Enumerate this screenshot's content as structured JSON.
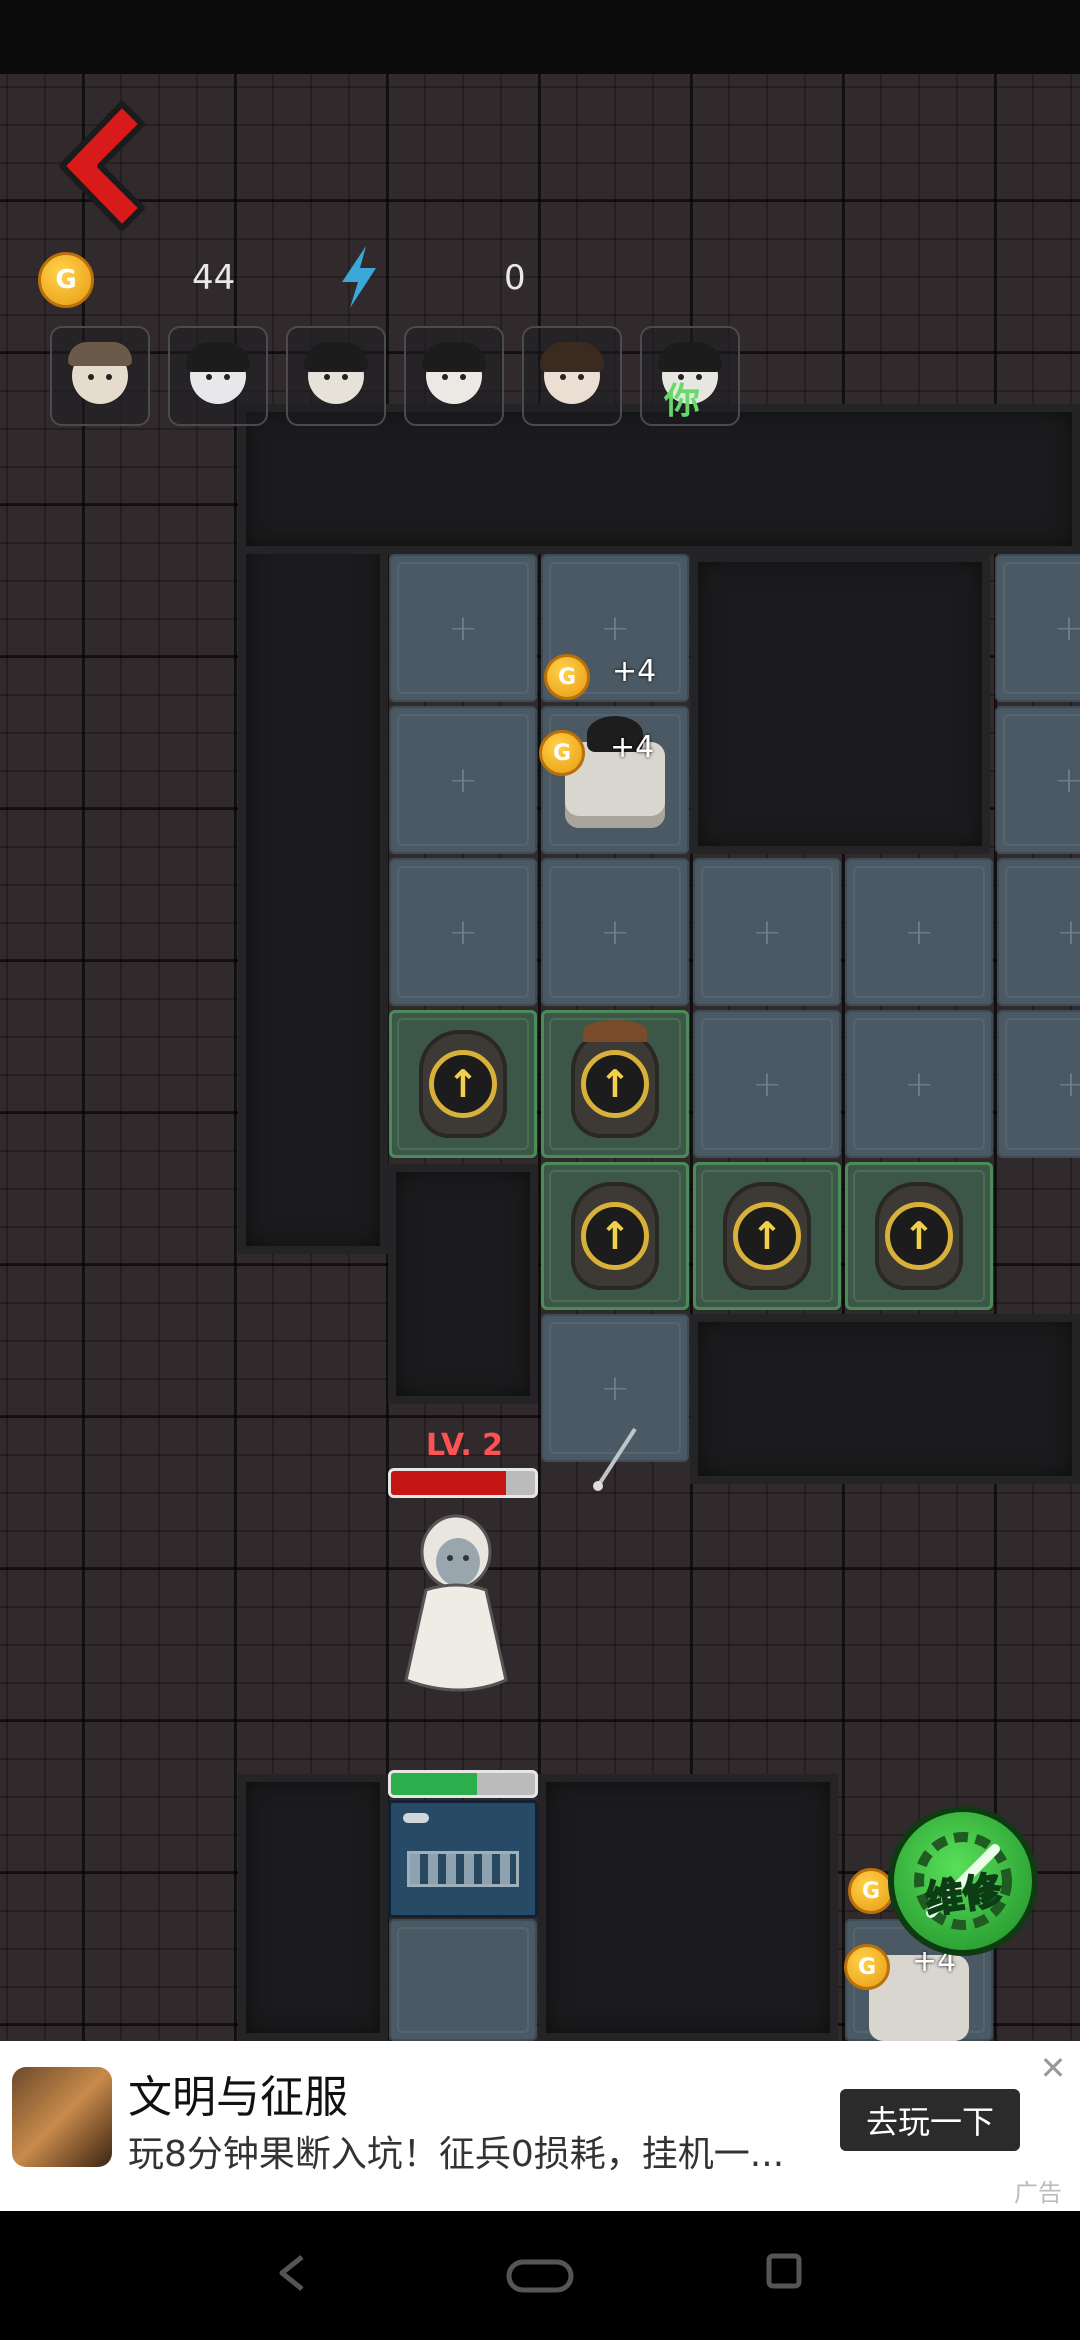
{
  "hud": {
    "coins": "44",
    "energy": "0",
    "coin_icon_letter": "G"
  },
  "characters": [
    {
      "icon": "girl-face-icon",
      "label": ""
    },
    {
      "icon": "pale-girl-face-icon",
      "label": ""
    },
    {
      "icon": "boy-face-icon",
      "label": ""
    },
    {
      "icon": "headphones-girl-face-icon",
      "label": ""
    },
    {
      "icon": "brown-hair-face-icon",
      "label": ""
    },
    {
      "icon": "player-face-icon",
      "label": "你"
    }
  ],
  "board": {
    "gains": [
      "+4",
      "+4",
      "+4"
    ],
    "enemy_level": "LV. 2",
    "enemy_hp_fraction": 0.8,
    "door_hp_fraction": 0.6
  },
  "repair_button": {
    "label": "维修"
  },
  "ad": {
    "title": "文明与征服",
    "description": "玩8分钟果断入坑！征兵0损耗，挂机一...",
    "cta": "去玩一下",
    "tag": "广告",
    "close": "✕"
  },
  "nav": [
    "back-nav-icon",
    "home-nav-icon",
    "recents-nav-icon"
  ]
}
